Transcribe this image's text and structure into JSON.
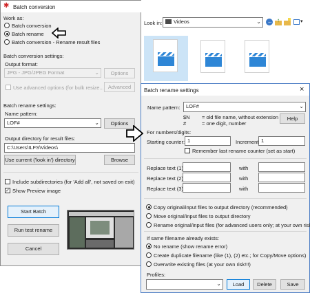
{
  "main": {
    "title": "Batch conversion",
    "work_as": {
      "label": "Work as:",
      "options": [
        "Batch conversion",
        "Batch rename",
        "Batch conversion - Rename result files"
      ],
      "selected_index": 1
    },
    "conversion_settings": {
      "label": "Batch conversion settings:",
      "output_format_label": "Output format:",
      "output_format_value": "JPG - JPG/JPEG Format",
      "options_button": "Options",
      "advanced_check_label": "Use advanced options (for bulk resize...)",
      "advanced_button": "Advanced"
    },
    "rename_settings": {
      "label": "Batch rename settings:",
      "name_pattern_label": "Name pattern:",
      "name_pattern_value": "LOF#",
      "options_button": "Options"
    },
    "output_dir": {
      "label": "Output directory for result files:",
      "value": "C:\\Users\\ILFS\\Videos\\",
      "use_current_button": "Use current ('look in') directory",
      "browse_button": "Browse"
    },
    "include_subdirs_label": "Include subdirectories (for 'Add all', not saved on exit)",
    "include_subdirs_checked": false,
    "show_preview_label": "Show Preview image",
    "show_preview_checked": true,
    "start_batch_button": "Start Batch",
    "run_test_button": "Run test rename",
    "cancel_button": "Cancel"
  },
  "browser": {
    "look_in_label": "Look in:",
    "look_in_value": "Videos",
    "file_labels": [
      "",
      "",
      ""
    ]
  },
  "dialog": {
    "title": "Batch rename settings",
    "close_label": "×",
    "name_pattern_label": "Name pattern:",
    "name_pattern_value": "LOF#",
    "help_button": "Help",
    "legend": [
      {
        "key": "$N",
        "desc": "= old file name, without extension"
      },
      {
        "key": "#",
        "desc": "= one digit, number"
      }
    ],
    "digits_label": "For numbers/digits:",
    "starting_counter_label": "Starting counter:",
    "starting_counter_value": "1",
    "increment_label": "Increment:",
    "increment_value": "1",
    "remember_label": "Remember last rename counter (set as start)",
    "remember_checked": false,
    "replace_rows": [
      {
        "label": "Replace text (1):",
        "with": "with"
      },
      {
        "label": "Replace text (2):",
        "with": "with"
      },
      {
        "label": "Replace text (3):",
        "with": "with"
      }
    ],
    "file_options": [
      "Copy original/input files to output directory (recommended)",
      "Move original/input files to output directory",
      "Rename original/input files (for advanced users only; at your own risk!!!)"
    ],
    "file_option_selected": 0,
    "exists_label": "If same filename already exists:",
    "exists_options": [
      "No rename (show rename error)",
      "Create duplicate filename (like (1), (2) etc.; for Copy/Move options)",
      "Overwrite existing files (at your own risk!!!)"
    ],
    "exists_selected": 0,
    "profiles_label": "Profiles:",
    "profiles_value": "",
    "load_button": "Load",
    "delete_button": "Delete",
    "save_button": "Save"
  },
  "colors": {
    "accent": "#0078d7",
    "clapper_blue": "#2e86d6",
    "pointer_arrow": "#000000"
  }
}
